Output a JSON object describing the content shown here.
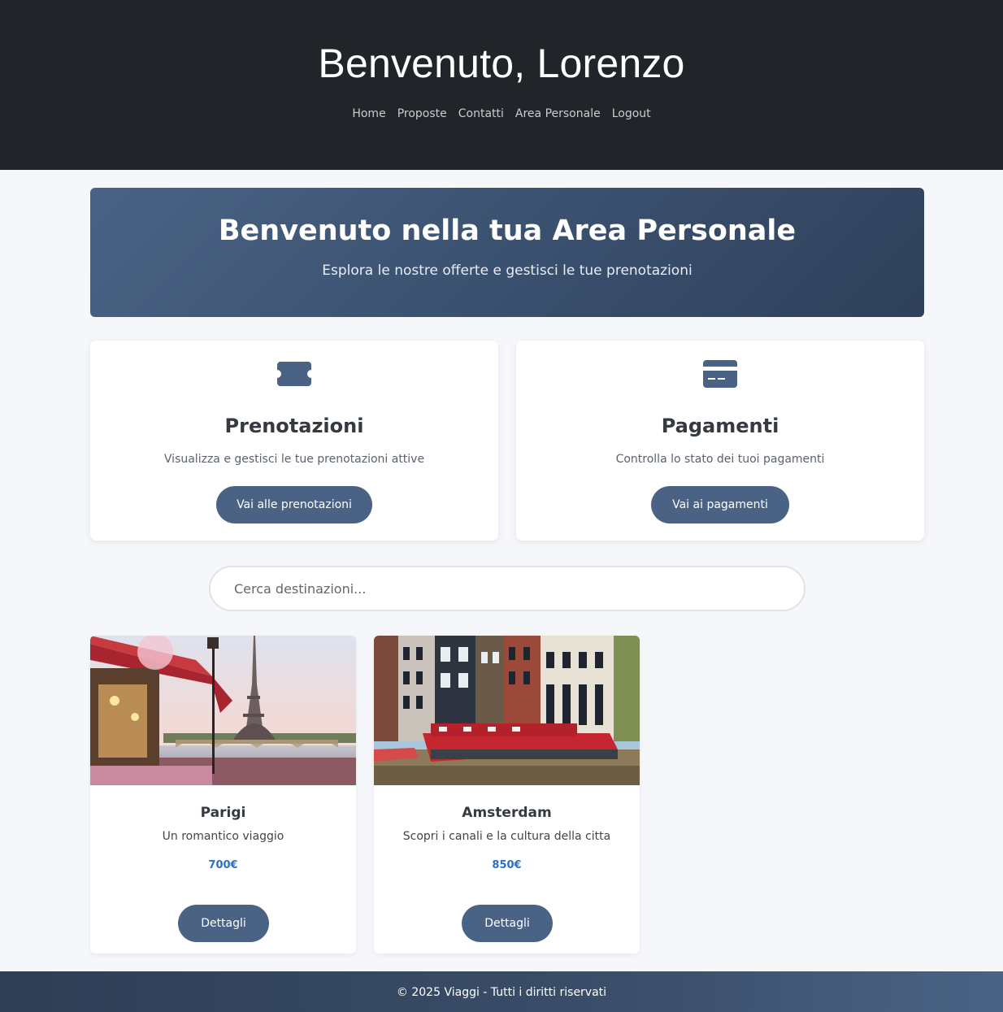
{
  "header": {
    "title": "Benvenuto, Lorenzo",
    "nav": [
      "Home",
      "Proposte",
      "Contatti",
      "Area Personale",
      "Logout"
    ]
  },
  "hero": {
    "title": "Benvenuto nella tua Area Personale",
    "subtitle": "Esplora le nostre offerte e gestisci le tue prenotazioni"
  },
  "features": [
    {
      "icon": "ticket-icon",
      "title": "Prenotazioni",
      "description": "Visualizza e gestisci le tue prenotazioni attive",
      "button": "Vai alle prenotazioni"
    },
    {
      "icon": "credit-card-icon",
      "title": "Pagamenti",
      "description": "Controlla lo stato dei tuoi pagamenti",
      "button": "Vai ai pagamenti"
    }
  ],
  "search": {
    "placeholder": "Cerca destinazioni...",
    "value": ""
  },
  "destinations": [
    {
      "name": "Parigi",
      "description": "Un romantico viaggio",
      "price": "700€",
      "button": "Dettagli"
    },
    {
      "name": "Amsterdam",
      "description": "Scopri i canali e la cultura della citta",
      "price": "850€",
      "button": "Dettagli"
    }
  ],
  "footer": {
    "text": "© 2025 Viaggi - Tutti i diritti riservati"
  },
  "colors": {
    "header_bg": "#212529",
    "accent": "#4a6385",
    "price": "#2d6fc4",
    "page_bg": "#f5f7fa"
  }
}
